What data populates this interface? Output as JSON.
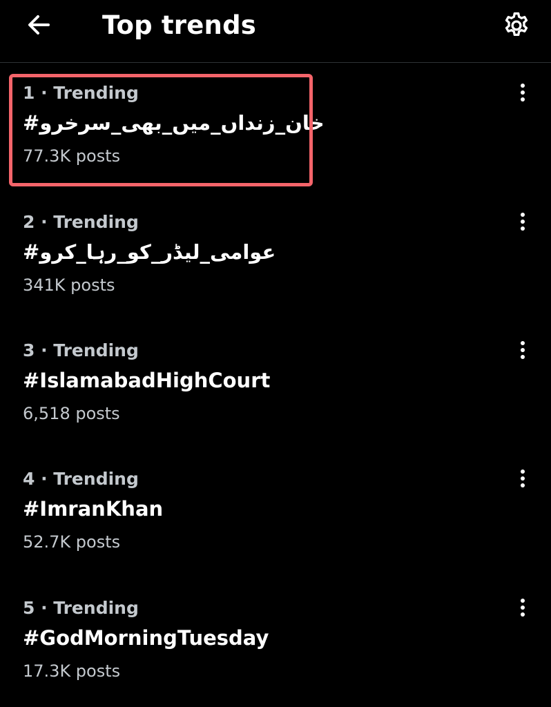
{
  "header": {
    "title": "Top trends",
    "back_icon": "arrow-left-icon",
    "settings_icon": "gear-icon"
  },
  "trends": [
    {
      "meta": "1 · Trending",
      "name": "#خان_زنداں_میں_بھی_سرخرو",
      "count": "77.3K posts",
      "highlighted": true
    },
    {
      "meta": "2 · Trending",
      "name": "#عوامی_لیڈر_کو_رہا_کرو",
      "count": "341K posts",
      "highlighted": false
    },
    {
      "meta": "3 · Trending",
      "name": "#IslamabadHighCourt",
      "count": "6,518 posts",
      "highlighted": false
    },
    {
      "meta": "4 · Trending",
      "name": "#ImranKhan",
      "count": "52.7K posts",
      "highlighted": false
    },
    {
      "meta": "5 · Trending",
      "name": "#GodMorningTuesday",
      "count": "17.3K posts",
      "highlighted": false
    }
  ],
  "colors": {
    "background": "#000000",
    "primary_text": "#ffffff",
    "secondary_text": "#c4c9ce",
    "divider": "#2f3336",
    "highlight": "#f4646a"
  },
  "more_icon": "more-vertical-icon"
}
